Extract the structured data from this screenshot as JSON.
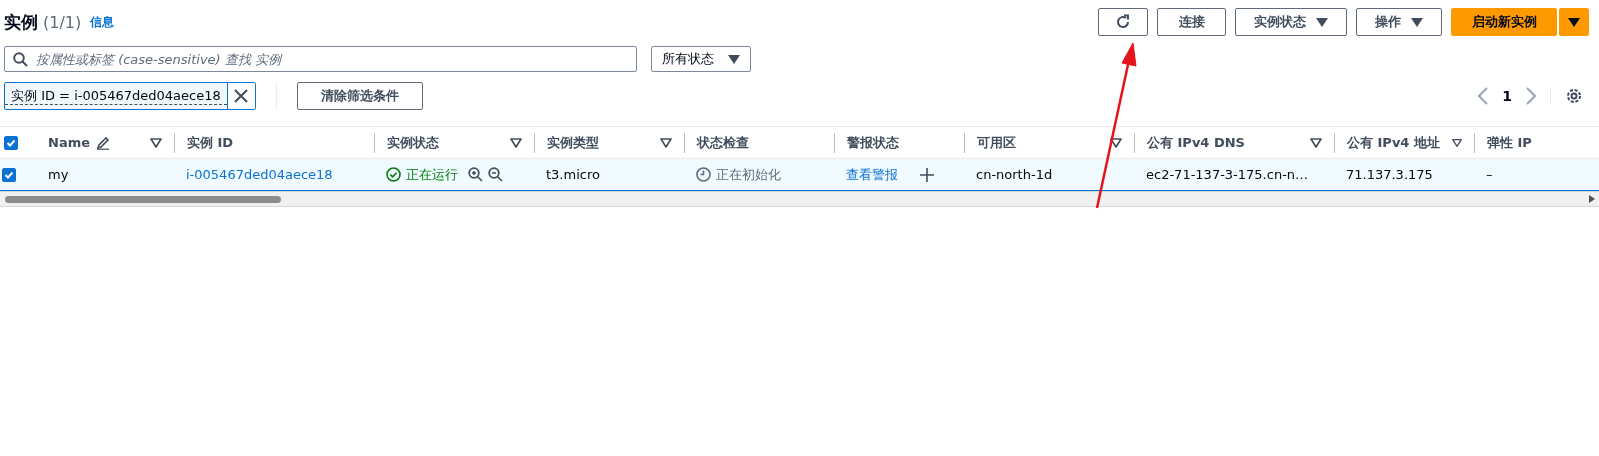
{
  "header": {
    "title": "实例",
    "count": "(1/1)",
    "info_link": "信息"
  },
  "actions": [
    {
      "kind": "refresh"
    },
    {
      "kind": "plain",
      "label": "连接"
    },
    {
      "kind": "dropdown",
      "label": "实例状态"
    },
    {
      "kind": "dropdown",
      "label": "操作"
    },
    {
      "kind": "primary-split",
      "label": "启动新实例"
    }
  ],
  "search": {
    "placeholder": "按属性或标签 (case-sensitive) 查找 实例"
  },
  "state_filter": {
    "value": "所有状态"
  },
  "filter_token": {
    "label": "实例 ID = i-005467ded04aece18"
  },
  "clear_filters_button": "清除筛选条件",
  "pagination": {
    "page": "1"
  },
  "table": {
    "all_selected": true,
    "columns": [
      {
        "label": "Name",
        "editable": true,
        "filterable": true
      },
      {
        "label": "实例 ID",
        "editable": false,
        "filterable": false
      },
      {
        "label": "实例状态",
        "editable": false,
        "filterable": true
      },
      {
        "label": "实例类型",
        "editable": false,
        "filterable": true
      },
      {
        "label": "状态检查",
        "editable": false,
        "filterable": false
      },
      {
        "label": "警报状态",
        "editable": false,
        "filterable": false
      },
      {
        "label": "可用区",
        "editable": false,
        "filterable": true
      },
      {
        "label": "公有 IPv4 DNS",
        "editable": false,
        "filterable": true
      },
      {
        "label": "公有 IPv4 地址",
        "editable": false,
        "filterable": true
      },
      {
        "label": "弹性 IP",
        "editable": false,
        "filterable": false
      }
    ],
    "rows": [
      {
        "selected": true,
        "cells": [
          {
            "kind": "text",
            "text": "my"
          },
          {
            "kind": "link",
            "text": "i-005467ded04aece18"
          },
          {
            "kind": "state",
            "text": "正在运行"
          },
          {
            "kind": "text",
            "text": "t3.micro"
          },
          {
            "kind": "check",
            "text": "正在初始化"
          },
          {
            "kind": "alarm",
            "text": "查看警报"
          },
          {
            "kind": "text",
            "text": "cn-north-1d"
          },
          {
            "kind": "text",
            "text": "ec2-71-137-3-175.cn-n…"
          },
          {
            "kind": "text",
            "text": "71.137.3.175"
          },
          {
            "kind": "text",
            "text": "–"
          }
        ]
      }
    ]
  },
  "annotations": [
    {
      "kind": "arrow"
    }
  ]
}
